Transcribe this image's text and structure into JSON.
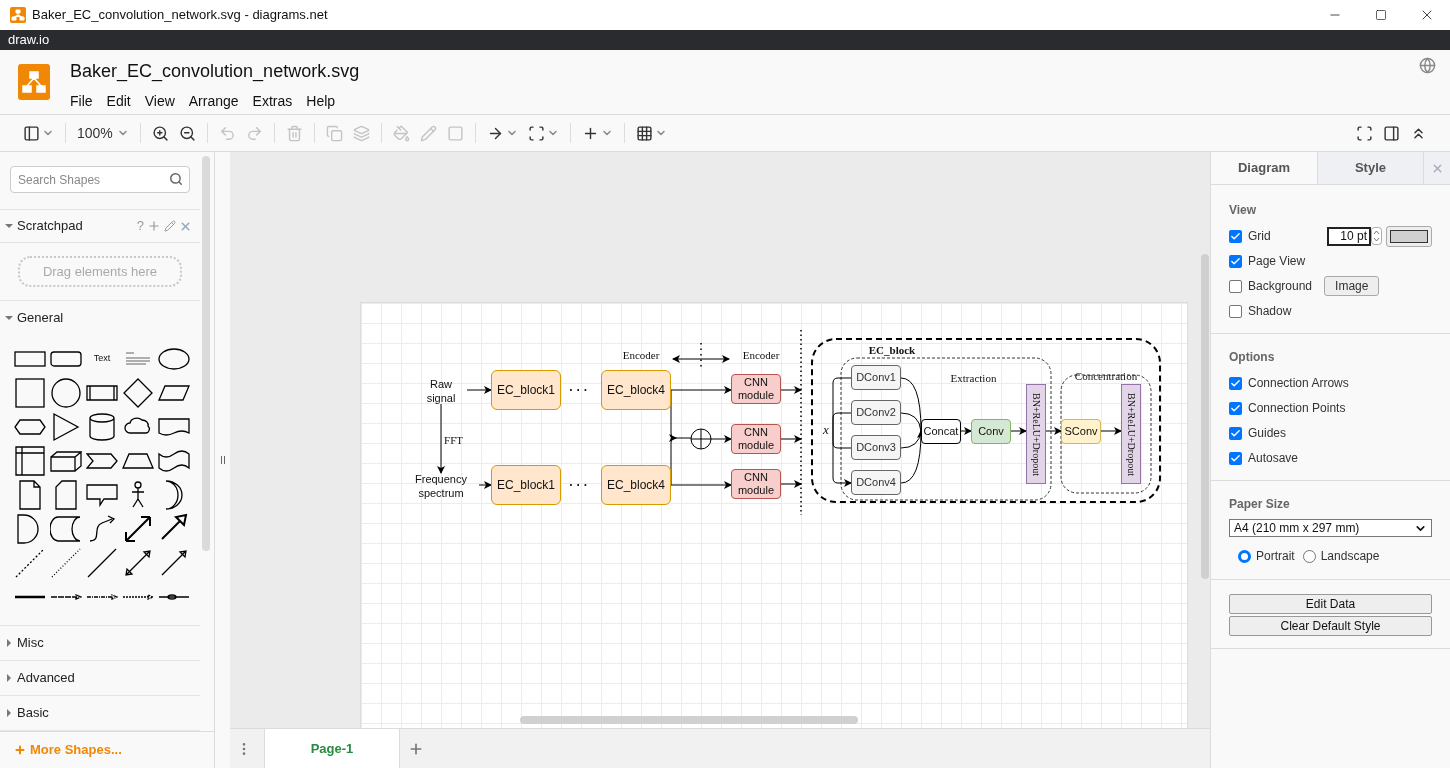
{
  "window": {
    "title": "Baker_EC_convolution_network.svg - diagrams.net"
  },
  "app_bar": {
    "title": "draw.io"
  },
  "document": {
    "title": "Baker_EC_convolution_network.svg",
    "menu": [
      "File",
      "Edit",
      "View",
      "Arrange",
      "Extras",
      "Help"
    ]
  },
  "toolbar": {
    "zoom": "100%"
  },
  "sidebar": {
    "search": {
      "placeholder": "Search Shapes"
    },
    "scratchpad": {
      "title": "Scratchpad",
      "expanded": true,
      "help": "?",
      "drop_hint": "Drag elements here"
    },
    "sections": [
      {
        "title": "General",
        "expanded": true
      },
      {
        "title": "Misc",
        "expanded": false
      },
      {
        "title": "Advanced",
        "expanded": false
      },
      {
        "title": "Basic",
        "expanded": false
      }
    ],
    "text_shape": "Text",
    "more_shapes": "More Shapes..."
  },
  "diagram": {
    "nodes": [
      {
        "kind": "caption",
        "label": "Encoder"
      },
      {
        "kind": "caption",
        "label": "Encoder"
      },
      {
        "kind": "text",
        "label": "Raw signal"
      },
      {
        "kind": "ec",
        "label": "EC_block1"
      },
      {
        "kind": "ellipsis",
        "label": "· · ·"
      },
      {
        "kind": "ec",
        "label": "EC_block4"
      },
      {
        "kind": "cnn",
        "label": "CNN module"
      },
      {
        "kind": "caption",
        "label": "FFT"
      },
      {
        "kind": "cnn",
        "label": "CNN module"
      },
      {
        "kind": "text",
        "label": "Frequency spectrum"
      },
      {
        "kind": "ec",
        "label": "EC_block1"
      },
      {
        "kind": "ellipsis",
        "label": "· · ·"
      },
      {
        "kind": "ec",
        "label": "EC_block4"
      },
      {
        "kind": "cnn",
        "label": "CNN module"
      },
      {
        "kind": "heading",
        "label": "EC_block"
      },
      {
        "kind": "caption",
        "label": "Extraction"
      },
      {
        "kind": "caption",
        "label": "Concentration"
      },
      {
        "kind": "math",
        "label": "x"
      },
      {
        "kind": "dconv",
        "label": "DConv1"
      },
      {
        "kind": "dconv",
        "label": "DConv2"
      },
      {
        "kind": "dconv",
        "label": "DConv3"
      },
      {
        "kind": "dconv",
        "label": "DConv4"
      },
      {
        "kind": "concat",
        "label": "Concat"
      },
      {
        "kind": "conv",
        "label": "Conv"
      },
      {
        "kind": "stack",
        "label": "BN+ReLU+Dropout"
      },
      {
        "kind": "sconv",
        "label": "SConv"
      },
      {
        "kind": "stack",
        "label": "BN+ReLU+Dropout"
      }
    ]
  },
  "pages": [
    {
      "label": "Page-1",
      "selected": true
    }
  ],
  "format_panel": {
    "tabs": [
      {
        "label": "Diagram",
        "selected": true
      },
      {
        "label": "Style",
        "selected": false
      }
    ],
    "view": {
      "title": "View",
      "grid": {
        "label": "Grid",
        "checked": true,
        "size": "10 pt"
      },
      "items": [
        {
          "label": "Page View",
          "checked": true
        },
        {
          "label": "Background",
          "checked": false,
          "button": "Image"
        },
        {
          "label": "Shadow",
          "checked": false
        }
      ]
    },
    "options": {
      "title": "Options",
      "items": [
        {
          "label": "Connection Arrows",
          "checked": true
        },
        {
          "label": "Connection Points",
          "checked": true
        },
        {
          "label": "Guides",
          "checked": true
        },
        {
          "label": "Autosave",
          "checked": true
        }
      ]
    },
    "paper": {
      "title": "Paper Size",
      "value": "A4 (210 mm x 297 mm)",
      "orientations": [
        {
          "label": "Portrait",
          "selected": true
        },
        {
          "label": "Landscape",
          "selected": false
        }
      ]
    },
    "buttons": [
      "Edit Data",
      "Clear Default Style"
    ]
  }
}
